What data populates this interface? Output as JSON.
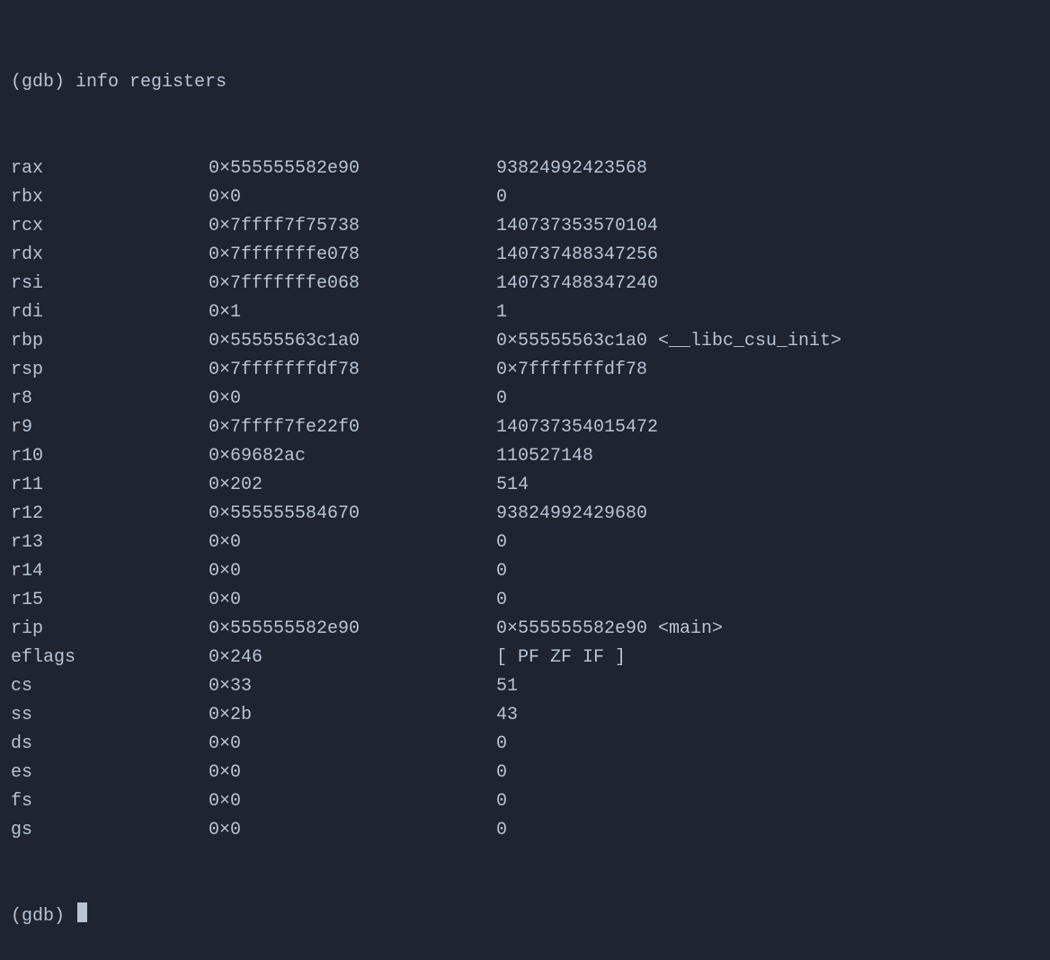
{
  "prompt": "(gdb) ",
  "command": "info registers",
  "registers": [
    {
      "name": "rax",
      "hex": "0×555555582e90",
      "dec": "93824992423568"
    },
    {
      "name": "rbx",
      "hex": "0×0",
      "dec": "0"
    },
    {
      "name": "rcx",
      "hex": "0×7ffff7f75738",
      "dec": "140737353570104"
    },
    {
      "name": "rdx",
      "hex": "0×7fffffffe078",
      "dec": "140737488347256"
    },
    {
      "name": "rsi",
      "hex": "0×7fffffffe068",
      "dec": "140737488347240"
    },
    {
      "name": "rdi",
      "hex": "0×1",
      "dec": "1"
    },
    {
      "name": "rbp",
      "hex": "0×55555563c1a0",
      "dec": "0×55555563c1a0 <__libc_csu_init>"
    },
    {
      "name": "rsp",
      "hex": "0×7fffffffdf78",
      "dec": "0×7fffffffdf78"
    },
    {
      "name": "r8",
      "hex": "0×0",
      "dec": "0"
    },
    {
      "name": "r9",
      "hex": "0×7ffff7fe22f0",
      "dec": "140737354015472"
    },
    {
      "name": "r10",
      "hex": "0×69682ac",
      "dec": "110527148"
    },
    {
      "name": "r11",
      "hex": "0×202",
      "dec": "514"
    },
    {
      "name": "r12",
      "hex": "0×555555584670",
      "dec": "93824992429680"
    },
    {
      "name": "r13",
      "hex": "0×0",
      "dec": "0"
    },
    {
      "name": "r14",
      "hex": "0×0",
      "dec": "0"
    },
    {
      "name": "r15",
      "hex": "0×0",
      "dec": "0"
    },
    {
      "name": "rip",
      "hex": "0×555555582e90",
      "dec": "0×555555582e90 <main>"
    },
    {
      "name": "eflags",
      "hex": "0×246",
      "dec": "[ PF ZF IF ]"
    },
    {
      "name": "cs",
      "hex": "0×33",
      "dec": "51"
    },
    {
      "name": "ss",
      "hex": "0×2b",
      "dec": "43"
    },
    {
      "name": "ds",
      "hex": "0×0",
      "dec": "0"
    },
    {
      "name": "es",
      "hex": "0×0",
      "dec": "0"
    },
    {
      "name": "fs",
      "hex": "0×0",
      "dec": "0"
    },
    {
      "name": "gs",
      "hex": "0×0",
      "dec": "0"
    }
  ],
  "prompt2": "(gdb) "
}
